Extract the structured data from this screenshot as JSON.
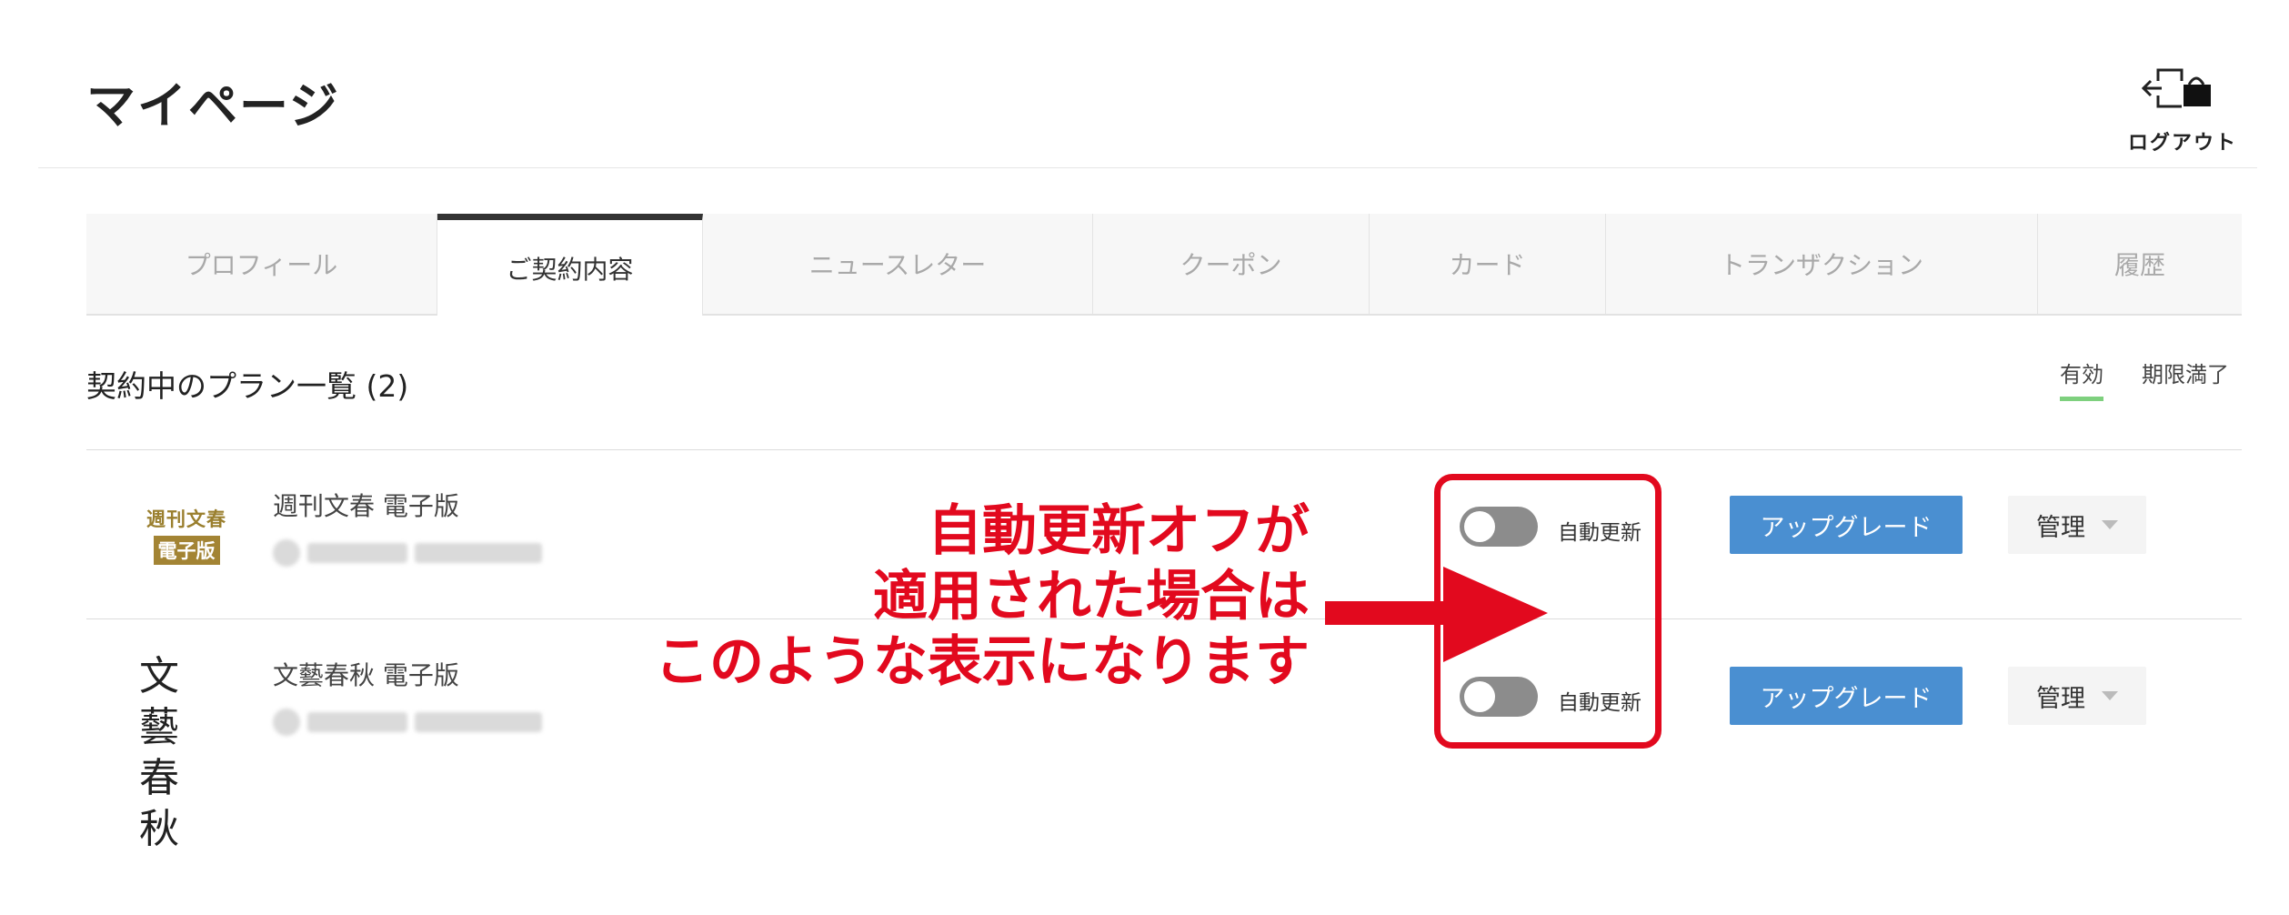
{
  "header": {
    "title": "マイページ",
    "logout_label": "ログアウト",
    "logout_icon": "logout-icon"
  },
  "tabs": [
    {
      "label": "プロフィール",
      "active": false
    },
    {
      "label": "ご契約内容",
      "active": true
    },
    {
      "label": "ニュースレター",
      "active": false
    },
    {
      "label": "クーポン",
      "active": false
    },
    {
      "label": "カード",
      "active": false
    },
    {
      "label": "トランザクション",
      "active": false
    },
    {
      "label": "履歴",
      "active": false
    }
  ],
  "plans_section": {
    "title": "契約中のプラン一覧 (2)",
    "filters": {
      "active": "有効",
      "expired": "期限満了"
    }
  },
  "plans": [
    {
      "logo_line1": "週刊文春",
      "logo_line2": "電子版",
      "name": "週刊文春 電子版",
      "auto_renew_label": "自動更新",
      "auto_renew_on": false,
      "upgrade_label": "アップグレード",
      "manage_label": "管理"
    },
    {
      "logo_line1": "文 藝",
      "logo_line2": "春 秋",
      "name": "文藝春秋 電子版",
      "auto_renew_label": "自動更新",
      "auto_renew_on": false,
      "upgrade_label": "アップグレード",
      "manage_label": "管理"
    }
  ],
  "annotation": {
    "line1": "自動更新オフが",
    "line2": "適用された場合は",
    "line3": "このような表示になります"
  },
  "colors": {
    "accent_blue": "#4a8fd1",
    "annotation_red": "#e2091e",
    "active_filter_green": "#7ed07e",
    "toggle_off_gray": "#8c8c8c"
  }
}
